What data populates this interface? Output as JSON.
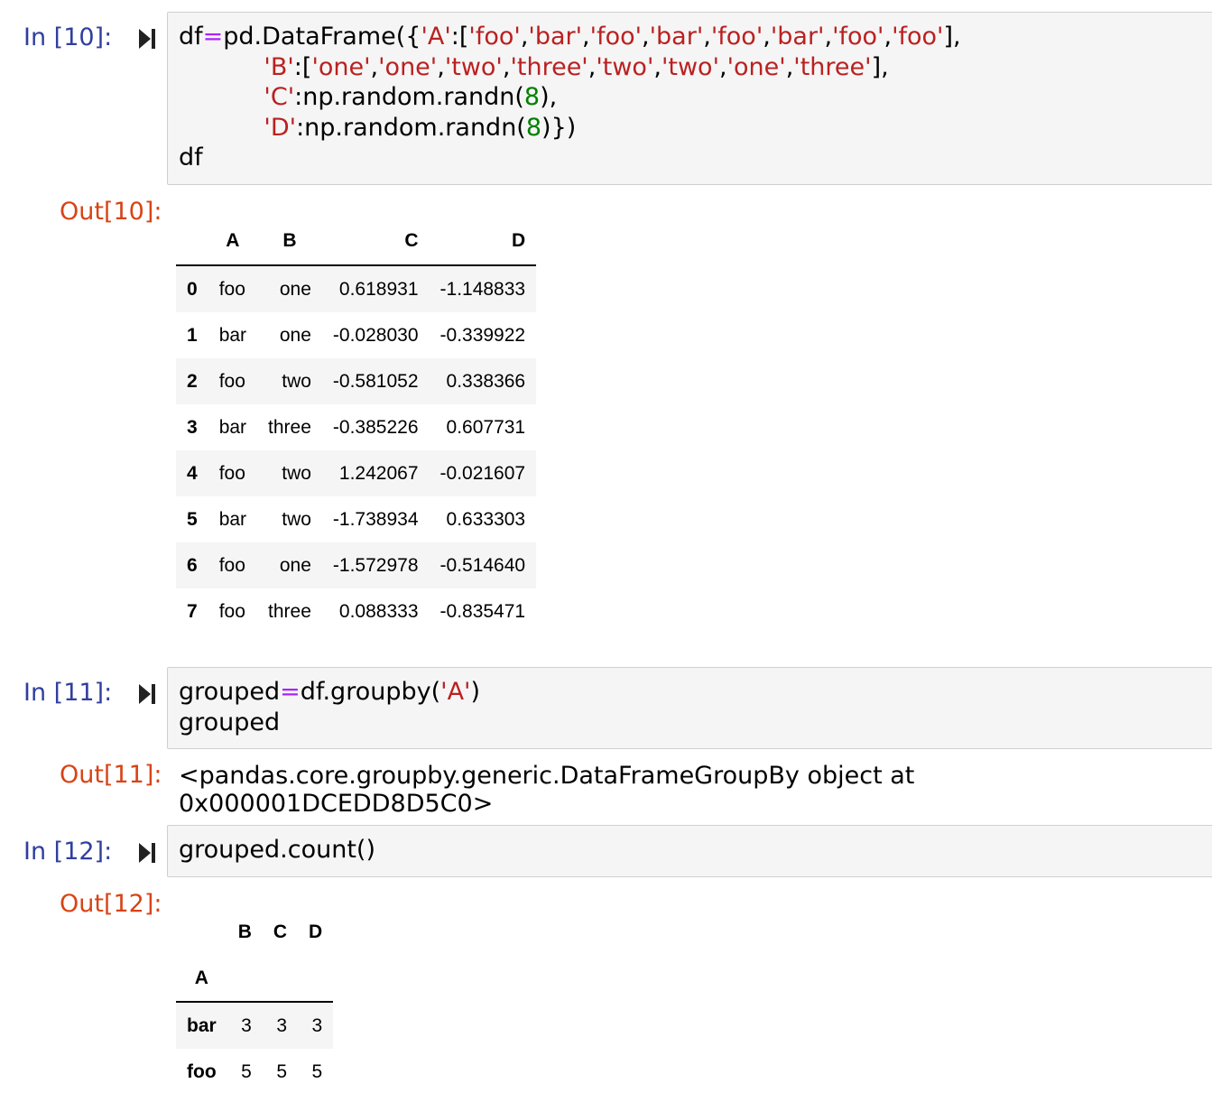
{
  "cells": [
    {
      "in_prompt": "In [10]:",
      "out_prompt": "Out[10]:",
      "table": {
        "columns": [
          "A",
          "B",
          "C",
          "D"
        ],
        "rows": [
          {
            "index": "0",
            "A": "foo",
            "B": "one",
            "C": "0.618931",
            "D": "-1.148833"
          },
          {
            "index": "1",
            "A": "bar",
            "B": "one",
            "C": "-0.028030",
            "D": "-0.339922"
          },
          {
            "index": "2",
            "A": "foo",
            "B": "two",
            "C": "-0.581052",
            "D": "0.338366"
          },
          {
            "index": "3",
            "A": "bar",
            "B": "three",
            "C": "-0.385226",
            "D": "0.607731"
          },
          {
            "index": "4",
            "A": "foo",
            "B": "two",
            "C": "1.242067",
            "D": "-0.021607"
          },
          {
            "index": "5",
            "A": "bar",
            "B": "two",
            "C": "-1.738934",
            "D": "0.633303"
          },
          {
            "index": "6",
            "A": "foo",
            "B": "one",
            "C": "-1.572978",
            "D": "-0.514640"
          },
          {
            "index": "7",
            "A": "foo",
            "B": "three",
            "C": "0.088333",
            "D": "-0.835471"
          }
        ]
      }
    },
    {
      "in_prompt": "In [11]:",
      "out_prompt": "Out[11]:",
      "output_text": "<pandas.core.groupby.generic.DataFrameGroupBy object at 0x000001DCEDD8D5C0>"
    },
    {
      "in_prompt": "In [12]:",
      "out_prompt": "Out[12]:",
      "code": "grouped.count()",
      "table": {
        "columns": [
          "B",
          "C",
          "D"
        ],
        "index_name": "A",
        "rows": [
          {
            "index": "bar",
            "B": "3",
            "C": "3",
            "D": "3"
          },
          {
            "index": "foo",
            "B": "5",
            "C": "5",
            "D": "5"
          }
        ]
      }
    }
  ],
  "code_tokens": {
    "c10_l1_a": "df",
    "c10_l1_op": "=",
    "c10_l1_b": "pd.DataFrame({",
    "c10_s_A": "'A'",
    "c10_colon": ":[",
    "c10_foo": "'foo'",
    "c10_bar": "'bar'",
    "comma": ",",
    "close_br": "],",
    "c10_s_B": "'B'",
    "c10_one": "'one'",
    "c10_two": "'two'",
    "c10_three": "'three'",
    "c10_s_C": "'C'",
    "c10_s_D": "'D'",
    "c10_randn": ":np.random.randn(",
    "c10_8": "8",
    "c10_close1": "),",
    "c10_close2": ")})",
    "c10_df": "df",
    "c11_a": "grouped",
    "c11_op": "=",
    "c11_b": "df.groupby(",
    "c11_s": "'A'",
    "c11_c": ")",
    "c11_l2": "grouped"
  }
}
